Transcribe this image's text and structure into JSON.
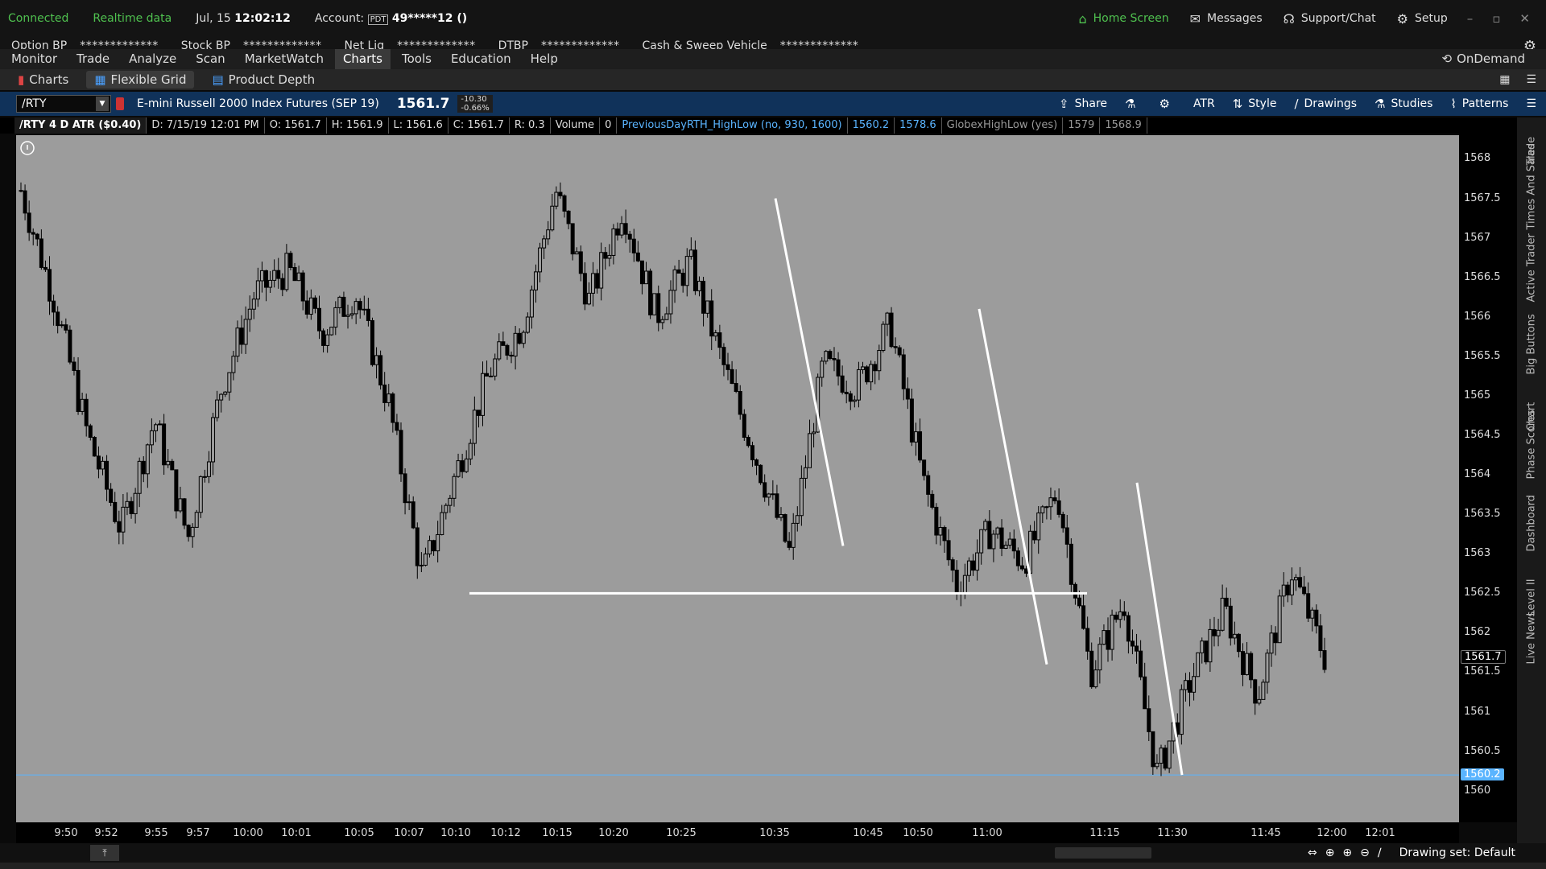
{
  "status": {
    "connected": "Connected",
    "realtime": "Realtime data",
    "date": "Jul, 15",
    "time": "12:02:12",
    "account_label": "Account:",
    "account_badge": "PDT",
    "account_value": "49*****12 ()",
    "home": "Home Screen",
    "messages": "Messages",
    "support": "Support/Chat",
    "setup": "Setup"
  },
  "balances": [
    {
      "label": "Option BP",
      "value": "*************"
    },
    {
      "label": "Stock BP",
      "value": "*************"
    },
    {
      "label": "Net Liq",
      "value": "*************"
    },
    {
      "label": "DTBP",
      "value": "*************"
    },
    {
      "label": "Cash & Sweep Vehicle",
      "value": "*************"
    }
  ],
  "menu": {
    "items": [
      "Monitor",
      "Trade",
      "Analyze",
      "Scan",
      "MarketWatch",
      "Charts",
      "Tools",
      "Education",
      "Help"
    ],
    "active": "Charts",
    "ondemand": "OnDemand"
  },
  "subtabs": {
    "charts": "Charts",
    "flexible_grid": "Flexible Grid",
    "product_depth": "Product Depth"
  },
  "toolbar": {
    "symbol": "/RTY",
    "description": "E-mini Russell 2000 Index Futures (SEP 19)",
    "price": "1561.7",
    "change": "-10.30",
    "change_pct": "-0.66%",
    "share": "Share",
    "atr": "ATR",
    "style": "Style",
    "drawings": "Drawings",
    "studies": "Studies",
    "patterns": "Patterns"
  },
  "infobar": {
    "title": "/RTY 4 D ATR ($0.40)",
    "date": "D: 7/15/19 12:01 PM",
    "open": "O: 1561.7",
    "high": "H: 1561.9",
    "low": "L: 1561.6",
    "close": "C: 1561.7",
    "range": "R: 0.3",
    "volume_label": "Volume",
    "volume": "0",
    "study1": "PreviousDayRTH_HighLow (no, 930, 1600)",
    "study1_v1": "1560.2",
    "study1_v2": "1578.6",
    "study2": "GlobexHighLow (yes)",
    "study2_v1": "1579",
    "study2_v2": "1568.9"
  },
  "chart_data": {
    "type": "candlestick",
    "ylim": [
      1559.6,
      1568.3
    ],
    "y_ticks": [
      "1568",
      "1567.5",
      "1567",
      "1566.5",
      "1566",
      "1565.5",
      "1565",
      "1564.5",
      "1564",
      "1563.5",
      "1563",
      "1562.5",
      "1562",
      "1561.5",
      "1561",
      "1560.5",
      "1560"
    ],
    "x_ticks": [
      "9:50",
      "9:52",
      "9:55",
      "9:57",
      "10:00",
      "10:01",
      "10:05",
      "10:07",
      "10:10",
      "10:12",
      "10:15",
      "10:20",
      "10:25",
      "10:35",
      "10:45",
      "10:50",
      "11:00",
      "11:15",
      "11:30",
      "11:45",
      "12:00",
      "12:01"
    ],
    "last_price": "1561.7",
    "prev_low": "1560.2",
    "close_path": [
      1567.6,
      1566.2,
      1564.5,
      1563.3,
      1564.7,
      1563.2,
      1565.1,
      1566.3,
      1566.6,
      1565.8,
      1566.3,
      1564.9,
      1562.7,
      1564.0,
      1565.3,
      1565.9,
      1567.6,
      1566.2,
      1567.4,
      1566.0,
      1566.7,
      1565.4,
      1564.2,
      1563.0,
      1565.4,
      1565.1,
      1565.9,
      1563.9,
      1562.6,
      1563.3,
      1562.9,
      1563.8,
      1561.5,
      1562.4,
      1560.2,
      1561.4,
      1562.3,
      1561.2,
      1562.8,
      1561.7
    ]
  },
  "sidebar_tabs": [
    "Trade",
    "Times And Sales",
    "Active Trader",
    "Big Buttons",
    "Chart",
    "Phase Scores",
    "Dashboard",
    "Level II",
    "Live News"
  ],
  "bottom": {
    "drawing_set": "Drawing set: Default"
  }
}
